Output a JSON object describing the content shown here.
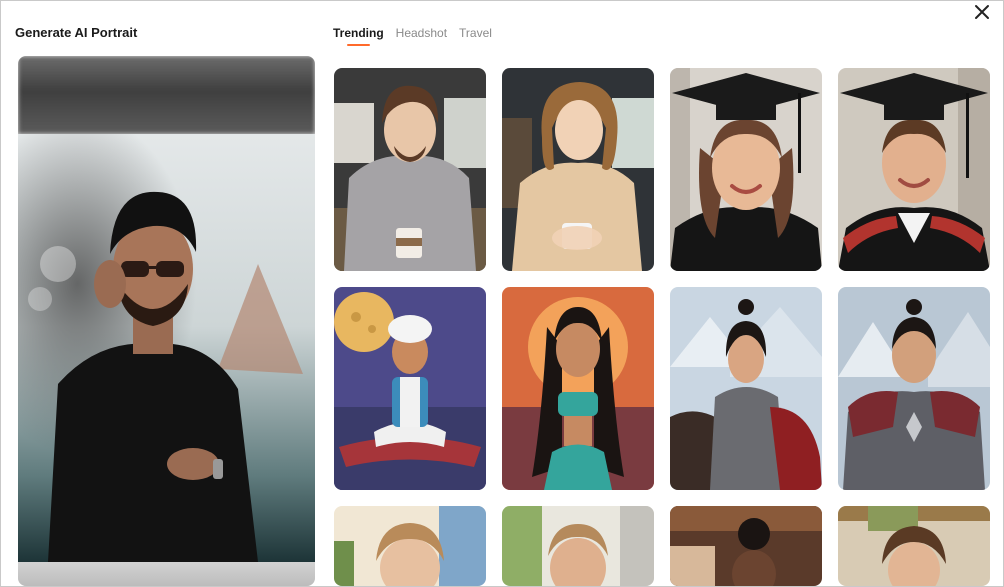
{
  "app": {
    "title": "Generate AI Portrait"
  },
  "tabs": [
    {
      "label": "Trending",
      "active": true
    },
    {
      "label": "Headshot",
      "active": false
    },
    {
      "label": "Travel",
      "active": false
    }
  ],
  "icons": {
    "close": "close-icon"
  },
  "colors": {
    "accent": "#ff6a2b",
    "title": "#1a1a1a",
    "tab_inactive": "#8a8a8a"
  },
  "templates": [
    {
      "id": "anime-man-coffee"
    },
    {
      "id": "anime-woman-coffee"
    },
    {
      "id": "graduation-woman"
    },
    {
      "id": "graduation-man"
    },
    {
      "id": "arabian-prince-carpet"
    },
    {
      "id": "arabian-princess"
    },
    {
      "id": "warrior-woman-horse"
    },
    {
      "id": "samurai-man-armor"
    },
    {
      "id": "woman-city"
    },
    {
      "id": "man-park"
    },
    {
      "id": "woman-cafe"
    },
    {
      "id": "woman-market"
    }
  ]
}
